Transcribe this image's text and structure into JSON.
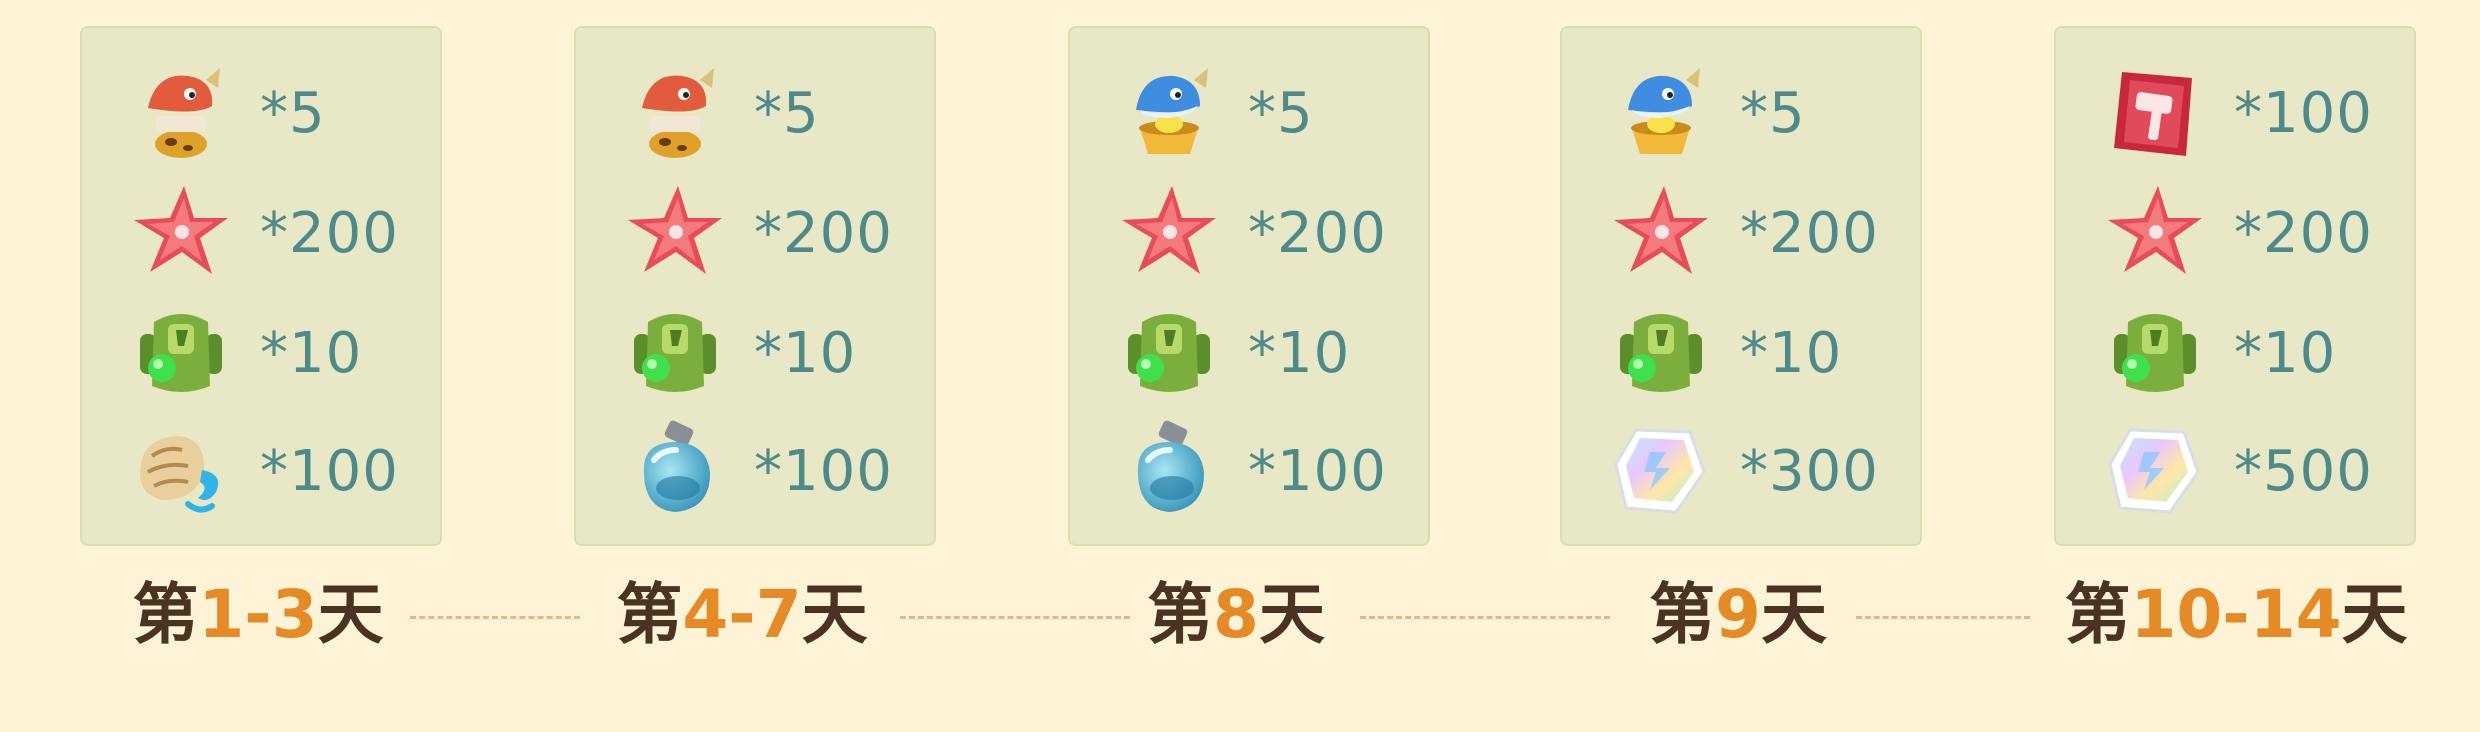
{
  "label_prefix": "第",
  "label_suffix": "天",
  "colors": {
    "background": "#fdf3d6",
    "card": "#e8e8c6",
    "quantity_text": "#4f8a8a",
    "label_text": "#4a3322",
    "label_number": "#e58a24",
    "connector": "#e6b48e"
  },
  "days": [
    {
      "range": "1-3",
      "items": [
        {
          "icon": "red-fish-chest-icon",
          "qty": "*5"
        },
        {
          "icon": "red-starfish-icon",
          "qty": "*200"
        },
        {
          "icon": "green-backpack-icon",
          "qty": "*10"
        },
        {
          "icon": "conch-shell-icon",
          "qty": "*100"
        }
      ]
    },
    {
      "range": "4-7",
      "items": [
        {
          "icon": "red-fish-chest-icon",
          "qty": "*5"
        },
        {
          "icon": "red-starfish-icon",
          "qty": "*200"
        },
        {
          "icon": "green-backpack-icon",
          "qty": "*10"
        },
        {
          "icon": "blue-potion-bottle-icon",
          "qty": "*100"
        }
      ]
    },
    {
      "range": "8",
      "items": [
        {
          "icon": "blue-fish-basket-icon",
          "qty": "*5"
        },
        {
          "icon": "red-starfish-icon",
          "qty": "*200"
        },
        {
          "icon": "green-backpack-icon",
          "qty": "*10"
        },
        {
          "icon": "blue-potion-bottle-icon",
          "qty": "*100"
        }
      ]
    },
    {
      "range": "9",
      "items": [
        {
          "icon": "blue-fish-basket-icon",
          "qty": "*5"
        },
        {
          "icon": "red-starfish-icon",
          "qty": "*200"
        },
        {
          "icon": "green-backpack-icon",
          "qty": "*10"
        },
        {
          "icon": "rainbow-crystal-icon",
          "qty": "*300"
        }
      ]
    },
    {
      "range": "10-14",
      "items": [
        {
          "icon": "red-hammer-card-icon",
          "qty": "*100"
        },
        {
          "icon": "red-starfish-icon",
          "qty": "*200"
        },
        {
          "icon": "green-backpack-icon",
          "qty": "*10"
        },
        {
          "icon": "rainbow-crystal-icon",
          "qty": "*500"
        }
      ]
    }
  ]
}
